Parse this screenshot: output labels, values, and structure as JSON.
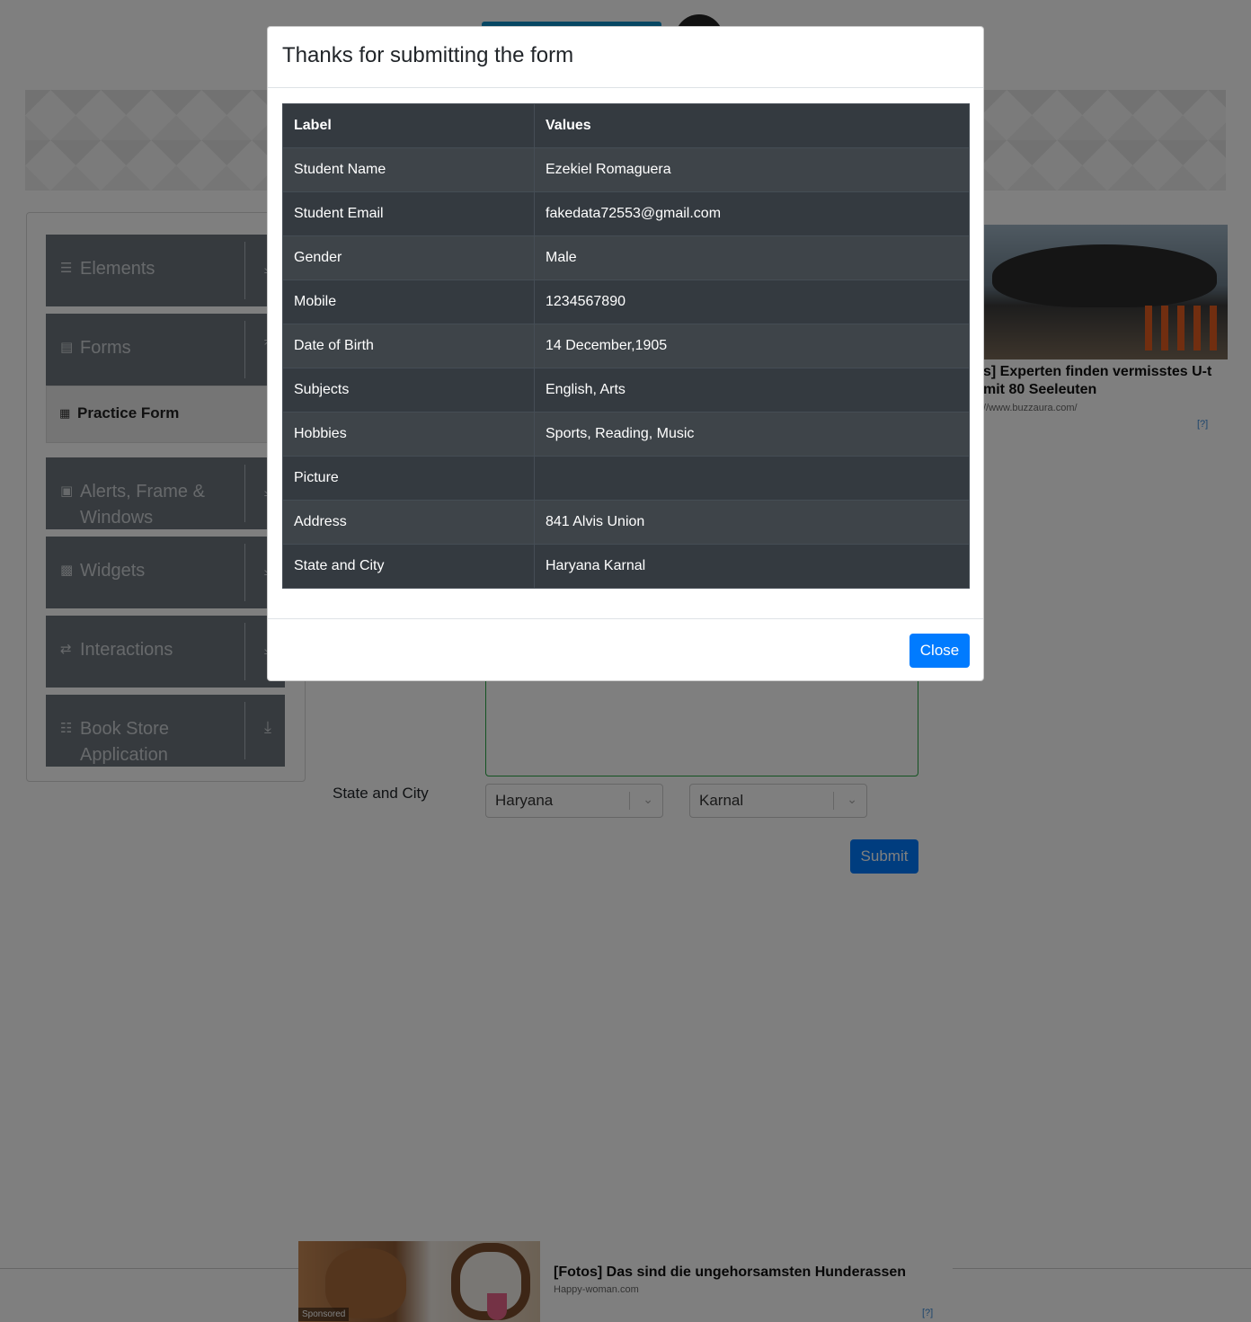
{
  "sidebar": {
    "groups": [
      {
        "label": "Elements"
      },
      {
        "label": "Forms"
      },
      {
        "label": "Alerts, Frame & Windows"
      },
      {
        "label": "Widgets"
      },
      {
        "label": "Interactions"
      },
      {
        "label": "Book Store Application"
      }
    ],
    "active_item": "Practice Form"
  },
  "form": {
    "state_city_label": "State and City",
    "state_value": "Haryana",
    "city_value": "Karnal",
    "submit_label": "Submit"
  },
  "ads": {
    "right": {
      "title": "s] Experten finden vermisstes U-­t mit 80 Seeleuten",
      "url": "//www.buzzaura.com/",
      "info": "[?]"
    },
    "bottom": {
      "title": "[Fotos] Das sind die ungehorsamsten Hunderassen",
      "url": "Happy-woman.com",
      "sponsored": "Sponsored",
      "info": "[?]"
    }
  },
  "modal": {
    "title": "Thanks for submitting the form",
    "headers": [
      "Label",
      "Values"
    ],
    "rows": [
      {
        "label": "Student Name",
        "value": "Ezekiel Romaguera"
      },
      {
        "label": "Student Email",
        "value": "fakedata72553@gmail.com"
      },
      {
        "label": "Gender",
        "value": "Male"
      },
      {
        "label": "Mobile",
        "value": "1234567890"
      },
      {
        "label": "Date of Birth",
        "value": "14 December,1905"
      },
      {
        "label": "Subjects",
        "value": "English, Arts"
      },
      {
        "label": "Hobbies",
        "value": "Sports, Reading, Music"
      },
      {
        "label": "Picture",
        "value": ""
      },
      {
        "label": "Address",
        "value": "841 Alvis Union"
      },
      {
        "label": "State and City",
        "value": "Haryana Karnal"
      }
    ],
    "close_label": "Close"
  }
}
